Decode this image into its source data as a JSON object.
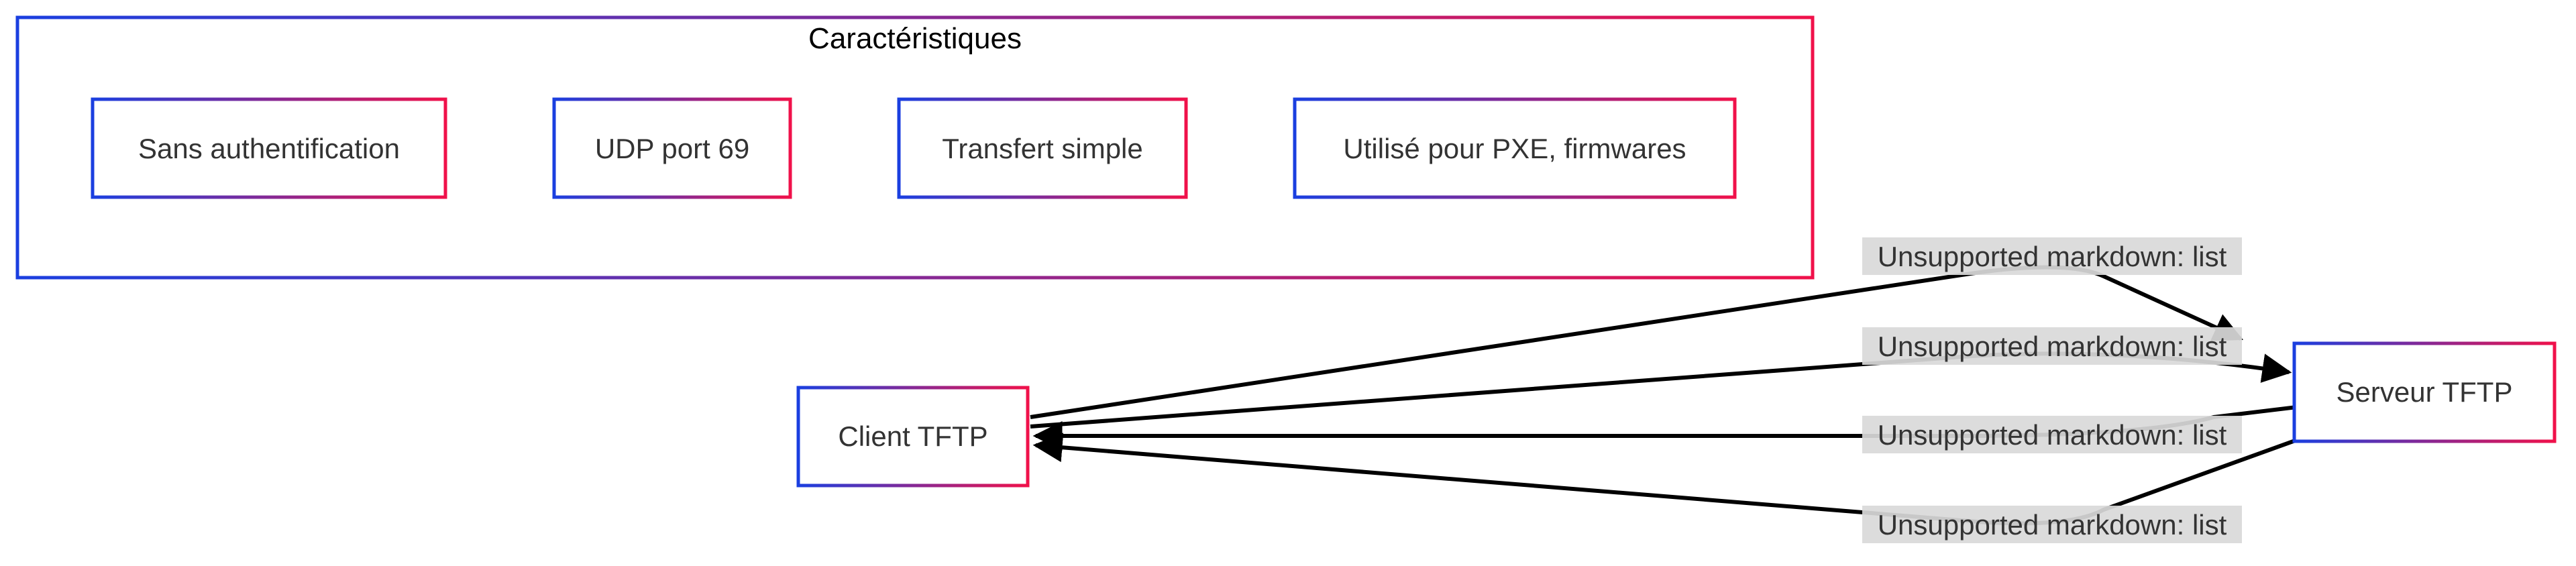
{
  "cluster": {
    "title": "Caractéristiques",
    "items": [
      "Sans authentification",
      "UDP port 69",
      "Transfert simple",
      "Utilisé pour PXE, firmwares"
    ]
  },
  "nodes": {
    "client": "Client TFTP",
    "server": "Serveur TFTP"
  },
  "edges": [
    {
      "from": "Client TFTP",
      "to": "Serveur TFTP",
      "label": "Unsupported markdown: list"
    },
    {
      "from": "Client TFTP",
      "to": "Serveur TFTP",
      "label": "Unsupported markdown: list"
    },
    {
      "from": "Serveur TFTP",
      "to": "Client TFTP",
      "label": "Unsupported markdown: list"
    },
    {
      "from": "Serveur TFTP",
      "to": "Client TFTP",
      "label": "Unsupported markdown: list"
    }
  ],
  "colors": {
    "border_start": "#1a3fe0",
    "border_end": "#f0114a",
    "edge": "#000000",
    "edge_label_bg": "#d9d9d9"
  }
}
